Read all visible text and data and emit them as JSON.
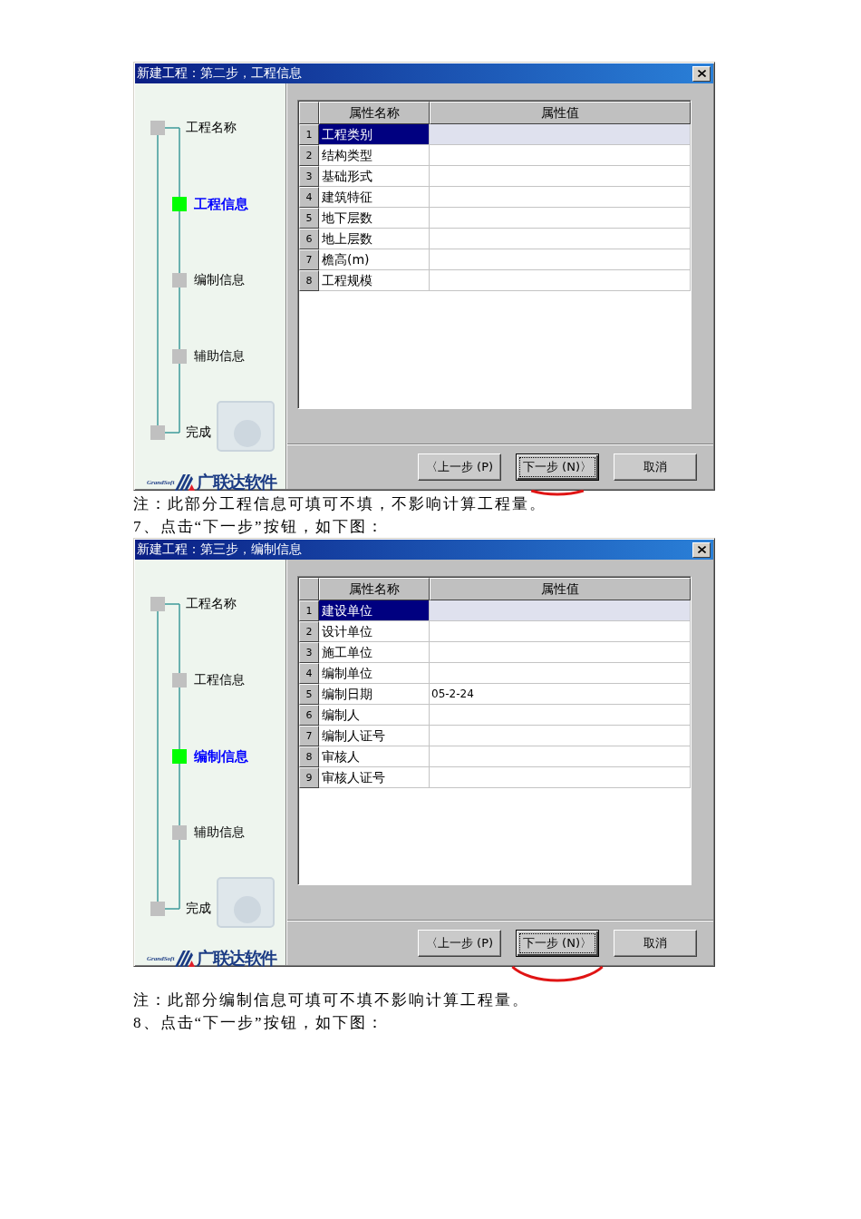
{
  "document": [
    {
      "kind": "dialog",
      "title": "新建工程：第二步，工程信息",
      "steps": [
        {
          "label": "工程名称",
          "kind": "terminal",
          "selected": false
        },
        {
          "label": "工程信息",
          "kind": "step",
          "selected": true
        },
        {
          "label": "编制信息",
          "kind": "step",
          "selected": false
        },
        {
          "label": "辅助信息",
          "kind": "step",
          "selected": false
        },
        {
          "label": "完成",
          "kind": "terminal",
          "selected": false
        }
      ],
      "logo": {
        "mark_text": "GrandSoft",
        "name": "广联达软件"
      },
      "table": {
        "columns": [
          "属性名称",
          "属性值"
        ],
        "rows": [
          {
            "number": "1",
            "name": "工程类别",
            "selected": true
          },
          {
            "number": "2",
            "name": "结构类型",
            "selected": false
          },
          {
            "number": "3",
            "name": "基础形式",
            "selected": false
          },
          {
            "number": "4",
            "name": "建筑特征",
            "selected": false
          },
          {
            "number": "5",
            "name": "地下层数",
            "selected": false
          },
          {
            "number": "6",
            "name": "地上层数",
            "selected": false
          },
          {
            "number": "7",
            "name": "檐高(m)",
            "selected": false
          },
          {
            "number": "8",
            "name": "工程规模",
            "selected": false
          }
        ]
      },
      "buttons": [
        {
          "label": "〈上一步 (P)",
          "focused": false,
          "circled": false
        },
        {
          "label": "下一步 (N)〉",
          "focused": true,
          "circled": true
        },
        {
          "label": "取消",
          "focused": false,
          "circled": false
        }
      ]
    },
    {
      "kind": "paragraph",
      "text": "注：此部分工程信息可填可不填，不影响计算工程量。"
    },
    {
      "kind": "paragraph",
      "text": "7、点击“下一步”按钮，如下图："
    },
    {
      "kind": "dialog",
      "title": "新建工程：第三步，编制信息",
      "steps": [
        {
          "label": "工程名称",
          "kind": "terminal",
          "selected": false
        },
        {
          "label": "工程信息",
          "kind": "step",
          "selected": false
        },
        {
          "label": "编制信息",
          "kind": "step",
          "selected": true
        },
        {
          "label": "辅助信息",
          "kind": "step",
          "selected": false
        },
        {
          "label": "完成",
          "kind": "terminal",
          "selected": false
        }
      ],
      "logo": {
        "mark_text": "GrandSoft",
        "name": "广联达软件"
      },
      "table": {
        "columns": [
          "属性名称",
          "属性值"
        ],
        "rows": [
          {
            "number": "1",
            "name": "建设单位",
            "selected": true
          },
          {
            "number": "2",
            "name": "设计单位",
            "selected": false
          },
          {
            "number": "3",
            "name": "施工单位",
            "selected": false
          },
          {
            "number": "4",
            "name": "编制单位",
            "selected": false
          },
          {
            "number": "5",
            "name": "编制日期",
            "value": "05-2-24",
            "selected": false
          },
          {
            "number": "6",
            "name": "编制人",
            "selected": false
          },
          {
            "number": "7",
            "name": "编制人证号",
            "selected": false
          },
          {
            "number": "8",
            "name": "审核人",
            "selected": false
          },
          {
            "number": "9",
            "name": "审核人证号",
            "selected": false
          }
        ]
      },
      "buttons": [
        {
          "label": "〈上一步 (P)",
          "focused": false,
          "circled": false
        },
        {
          "label": "下一步 (N)〉",
          "focused": true,
          "circled": true
        },
        {
          "label": "取消",
          "focused": false,
          "circled": false
        }
      ]
    },
    {
      "kind": "paragraph",
      "text": "注：此部分编制信息可填可不填不影响计算工程量。"
    },
    {
      "kind": "paragraph",
      "text": "8、点击“下一步”按钮，如下图："
    }
  ]
}
